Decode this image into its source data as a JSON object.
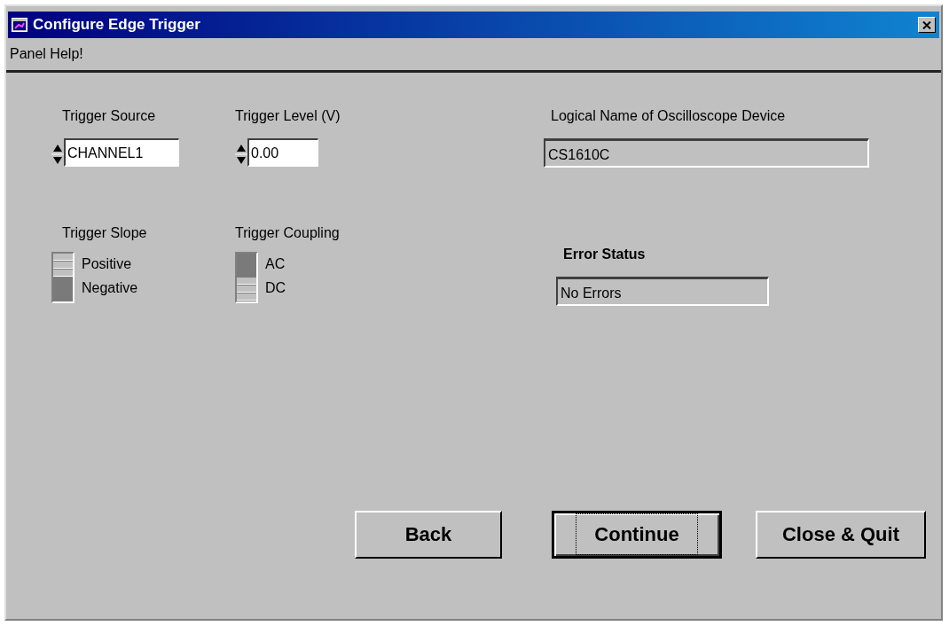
{
  "window": {
    "title": "Configure Edge Trigger"
  },
  "menu": [
    "Panel Help!"
  ],
  "trigger_source": {
    "label": "Trigger Source",
    "value": "CHANNEL1"
  },
  "trigger_level": {
    "label": "Trigger Level (V)",
    "value": "0.00"
  },
  "device": {
    "label": "Logical Name of Oscilloscope Device",
    "value": "CS1610C"
  },
  "trigger_slope": {
    "label": "Trigger Slope",
    "options": [
      {
        "label": "Positive",
        "selected": false
      },
      {
        "label": "Negative",
        "selected": true
      }
    ]
  },
  "trigger_coupling": {
    "label": "Trigger Coupling",
    "options": [
      {
        "label": "AC",
        "selected": true
      },
      {
        "label": "DC",
        "selected": false
      }
    ]
  },
  "error_status": {
    "label": "Error Status",
    "value": "No Errors"
  },
  "buttons": [
    {
      "label": "Back",
      "focused": false
    },
    {
      "label": "Continue",
      "focused": true
    },
    {
      "label": "Close & Quit",
      "focused": false
    }
  ]
}
